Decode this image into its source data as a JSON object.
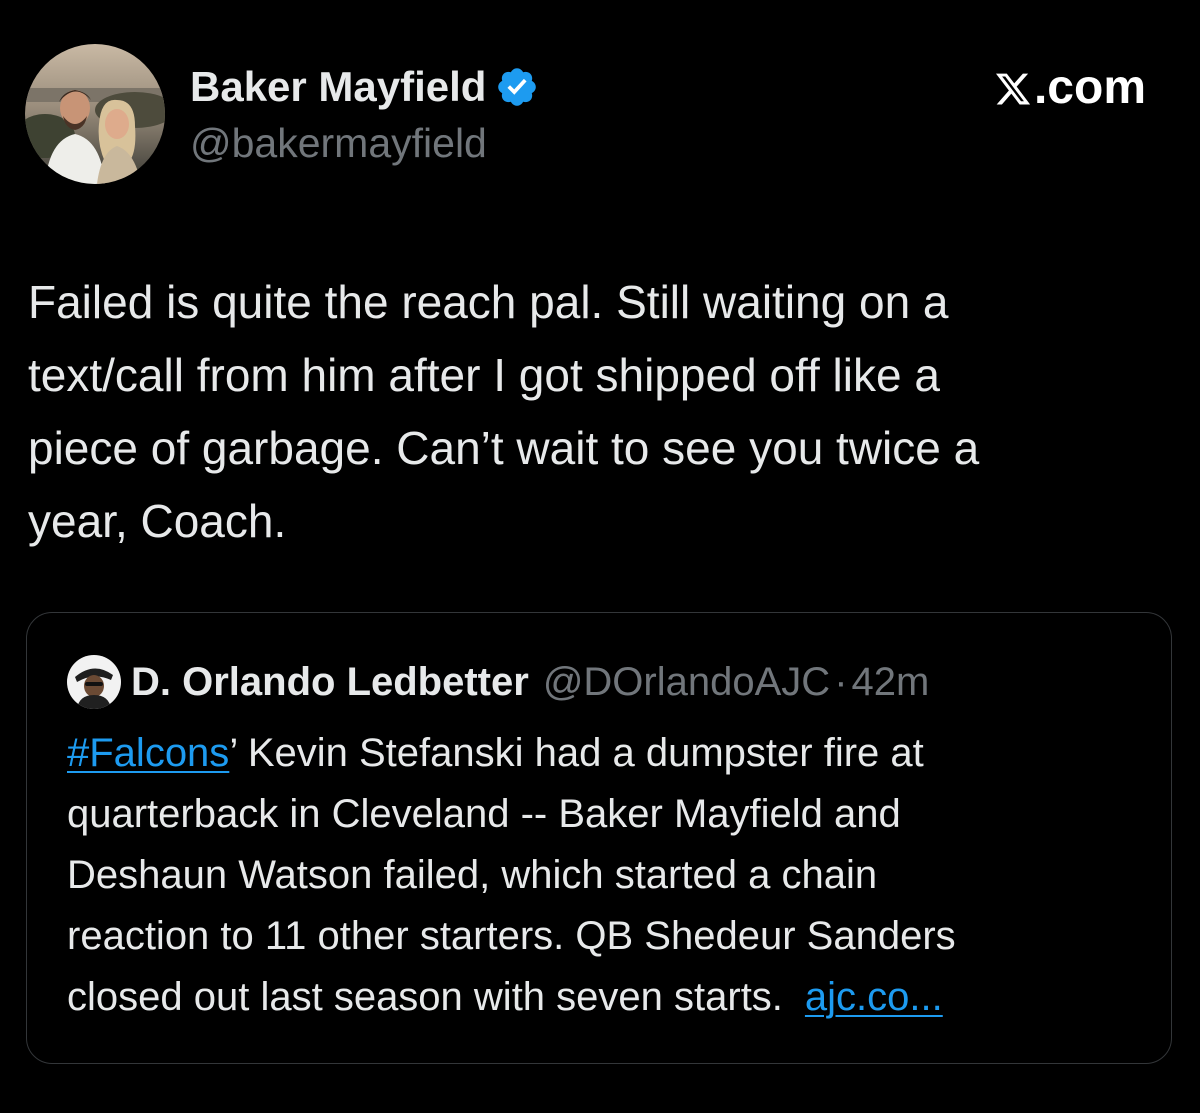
{
  "author": {
    "name": "Baker Mayfield",
    "handle": "@bakermayfield",
    "verified": true
  },
  "brand": {
    "label": ".com",
    "logo_icon": "x-logo-icon"
  },
  "post": {
    "text": "Failed is quite the reach pal. Still waiting on a\ntext/call from him after I got shipped off like a\npiece of garbage. Can’t wait to see you twice a\nyear, Coach."
  },
  "quoted": {
    "name": "D. Orlando Ledbetter",
    "handle": "@DOrlandoAJC",
    "separator": "·",
    "time": "42m",
    "hashtag": "#Falcons",
    "lines": [
      "’ Kevin Stefanski had a dumpster fire at",
      "quarterback in Cleveland -- Baker Mayfield and",
      "Deshaun Watson failed, which started a chain",
      "reaction to 11 other starters. QB Shedeur Sanders",
      "closed out last season with seven starts."
    ],
    "link_text": "ajc.co..."
  },
  "colors": {
    "background": "#000000",
    "text": "#e7e9ea",
    "secondary": "#71767b",
    "accent": "#1d9bf0",
    "border": "#333639"
  }
}
